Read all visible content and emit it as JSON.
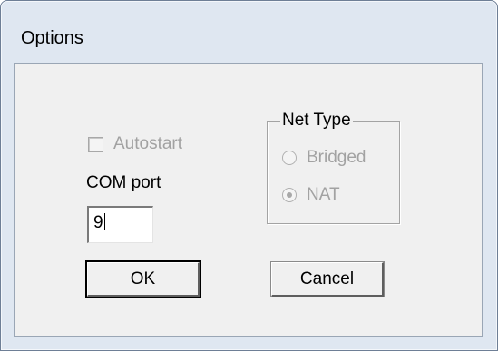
{
  "window": {
    "title": "Options"
  },
  "autostart": {
    "label": "Autostart",
    "checked": false,
    "enabled": false
  },
  "com_port": {
    "label": "COM port",
    "value": "9"
  },
  "net_type": {
    "label": "Net Type",
    "options": [
      {
        "label": "Bridged",
        "selected": false,
        "enabled": false
      },
      {
        "label": "NAT",
        "selected": true,
        "enabled": false
      }
    ]
  },
  "buttons": {
    "ok_label": "OK",
    "cancel_label": "Cancel"
  },
  "colors": {
    "disabled_text": "#a2a2a2",
    "dialog_face": "#f0f0f0",
    "frame": "#dfe7f1"
  }
}
